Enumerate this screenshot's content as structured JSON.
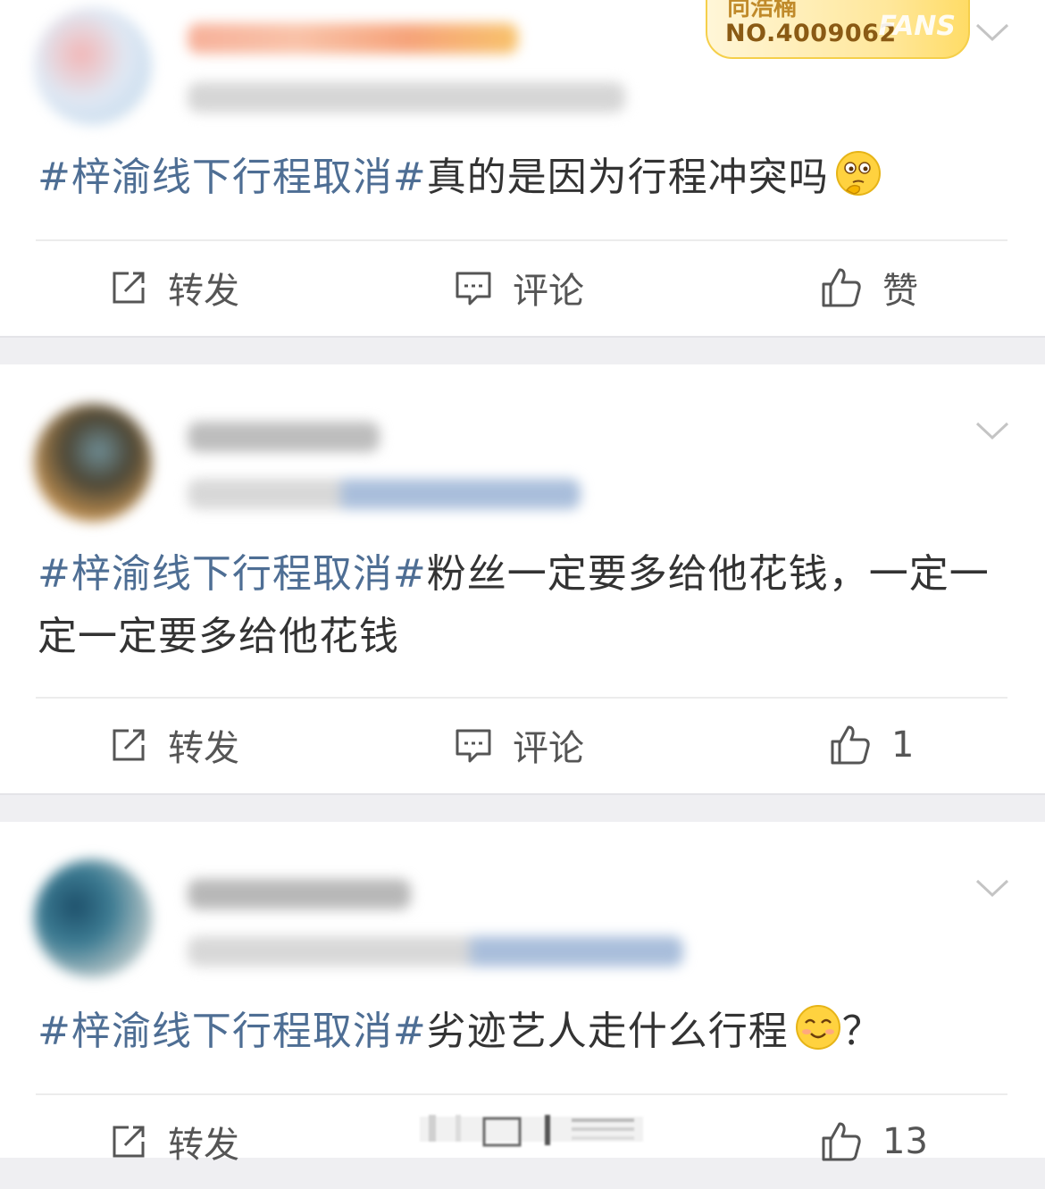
{
  "fans_badge": {
    "name": "向浩楠",
    "number": "NO.4009062",
    "word": "FANS"
  },
  "actions": {
    "repost_label": "转发",
    "comment_label": "评论",
    "like_label": "赞"
  },
  "posts": [
    {
      "tag": "#梓渝线下行程取消#",
      "text": "真的是因为行程冲突吗",
      "emoji": "thinking-face",
      "like_count": "赞"
    },
    {
      "tag": "#梓渝线下行程取消#",
      "text": "粉丝一定要多给他花钱，一定一定一定要多给他花钱",
      "like_count": "1"
    },
    {
      "tag": "#梓渝线下行程取消#",
      "text": "劣迹艺人走什么行程",
      "emoji": "smiling-face",
      "text_suffix": "？",
      "like_count": "13"
    }
  ],
  "colors": {
    "hashtag": "#4e6e94",
    "background": "#efeff2",
    "badge_gold": "#ffdc66"
  }
}
